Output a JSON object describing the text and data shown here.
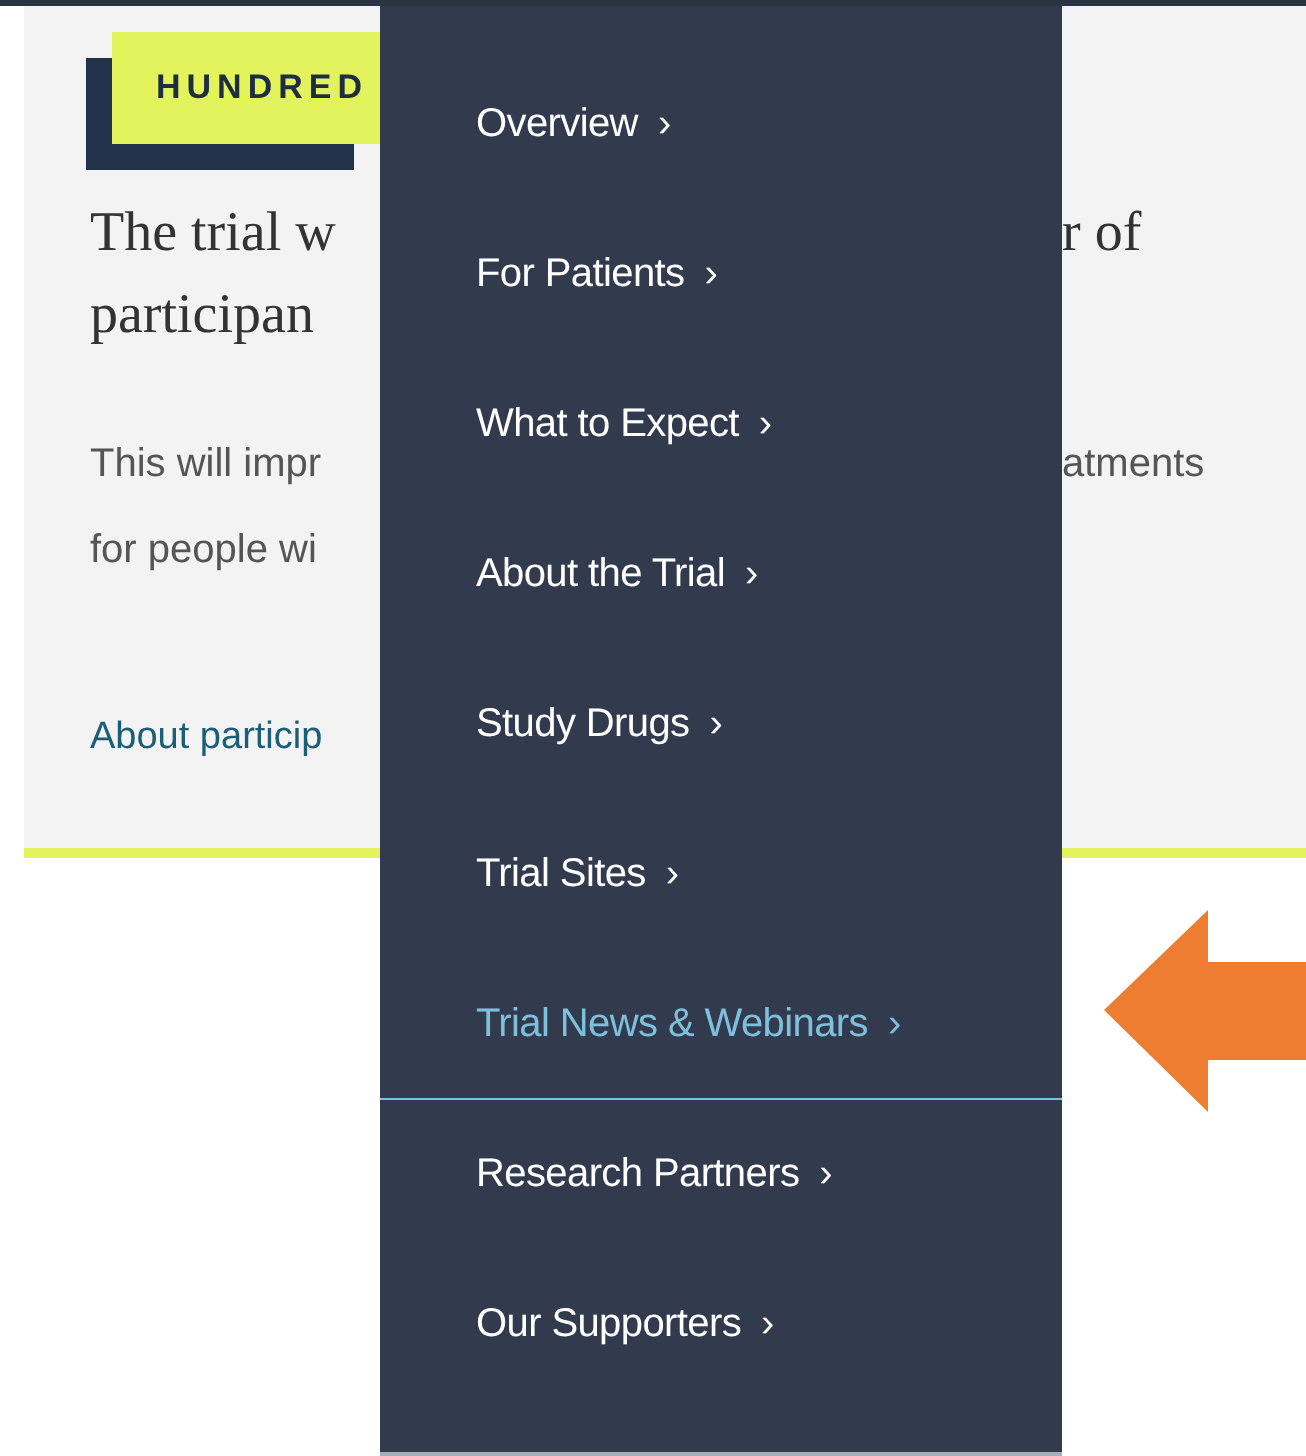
{
  "card": {
    "badge": "HUNDRED",
    "heading_lines": [
      {
        "left": "The trial w",
        "right": "r of"
      },
      {
        "left": "participan"
      }
    ],
    "paragraph_lines": [
      {
        "left": "This will impr",
        "right": "atments"
      },
      {
        "left": "for people wi"
      }
    ],
    "link": "About particip"
  },
  "menu": {
    "items": [
      {
        "label": "Overview",
        "chevron": "›",
        "selected": false
      },
      {
        "label": "For Patients",
        "chevron": "›",
        "selected": false
      },
      {
        "label": "What to Expect",
        "chevron": "›",
        "selected": false
      },
      {
        "label": "About the Trial",
        "chevron": "›",
        "selected": false
      },
      {
        "label": "Study Drugs",
        "chevron": "›",
        "selected": false
      },
      {
        "label": "Trial Sites",
        "chevron": "›",
        "selected": false
      },
      {
        "label": "Trial News & Webinars",
        "chevron": "›",
        "selected": true
      },
      {
        "label": "Research Partners",
        "chevron": "›",
        "selected": false
      },
      {
        "label": "Our Supporters",
        "chevron": "›",
        "selected": false
      }
    ]
  }
}
